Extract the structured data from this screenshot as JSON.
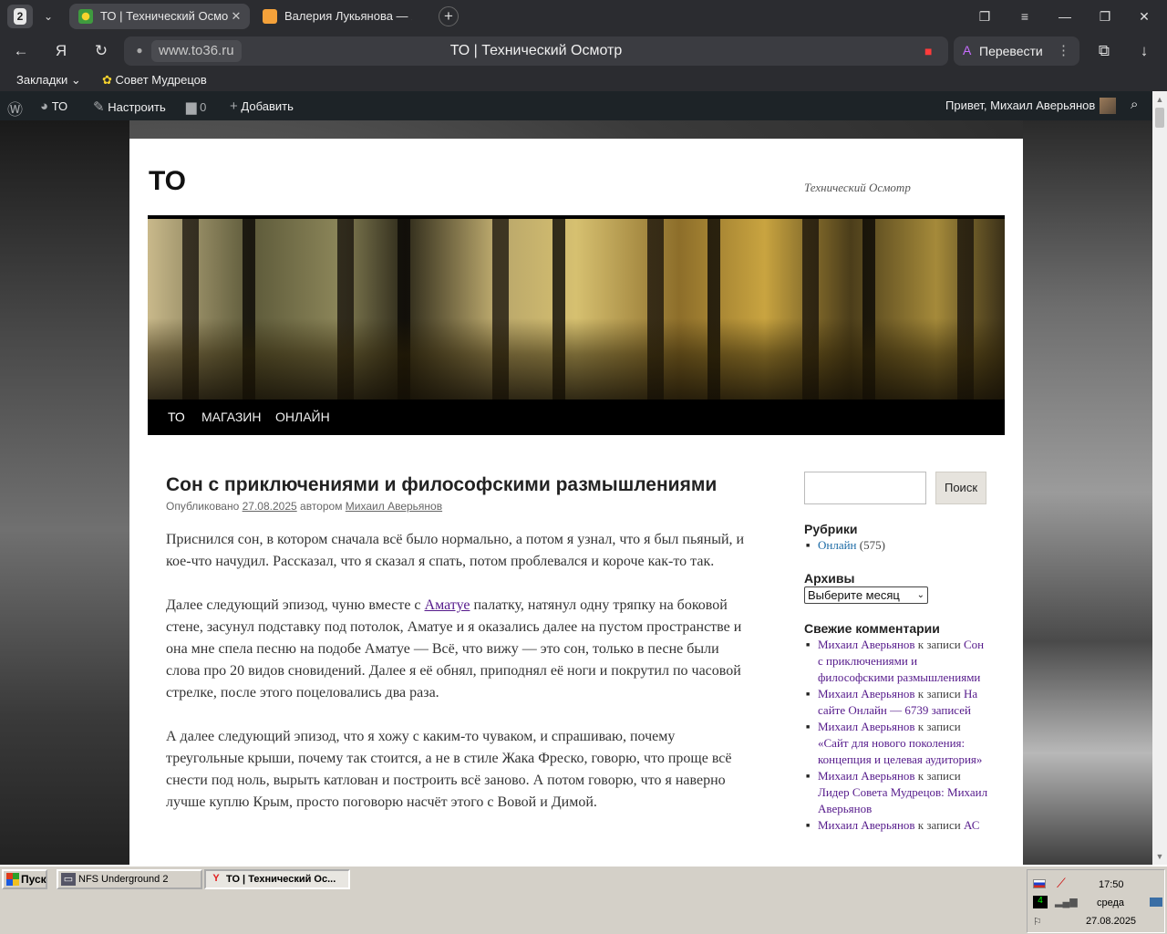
{
  "browser": {
    "tab_count": "2",
    "tabs": [
      {
        "title": "ТО | Технический Осмотр",
        "active": true
      },
      {
        "title": "Валерия Лукьянова — Я",
        "active": false
      }
    ],
    "url": "www.to36.ru",
    "page_title": "ТО | Технический Осмотр",
    "translate_label": "Перевести",
    "bookmarks_label": "Закладки",
    "bookmarks": [
      {
        "label": "Совет Мудрецов"
      }
    ],
    "colors": {
      "chrome": "#2b2c30",
      "bookmark_flag": "#ff3b3b"
    }
  },
  "adminbar": {
    "site": "ТО",
    "customize": "Настроить",
    "comments_count": "0",
    "add_new": "Добавить",
    "greeting": "Привет, Михаил Аверьянов"
  },
  "site": {
    "title": "ТО",
    "description": "Технический Осмотр",
    "menu": [
      {
        "label": "ТО",
        "current": true
      },
      {
        "label": "МАГАЗИН",
        "current": false
      },
      {
        "label": "ОНЛАЙН",
        "current": false
      }
    ]
  },
  "post": {
    "title": "Сон с приключениями и философскими размышлениями",
    "meta_prefix": "Опубликовано",
    "date": "27.08.2025",
    "meta_author_prefix": "автором",
    "author": "Михаил Аверьянов",
    "p1": "Приснился сон, в котором сначала всё было нормально, а потом я узнал, что я был пьяный, и кое-что начудил. Рассказал, что я сказал я спать, потом проблевался и короче как-то так.",
    "p2_before": "Далее следующий эпизод, чуню вместе с ",
    "p2_link": "Аматуе",
    "p2_after": " палатку, натянул одну тряпку на боковой стене, засунул подставку под потолок, Аматуе и я оказались далее на пустом пространстве и она мне спела песню на подобе Аматуе — Всё, что вижу — это сон, только в песне были слова про 20 видов сновидений. Далее я её обнял, приподнял её ноги и покрутил по часовой стрелке, после этого поцеловались два раза.",
    "p3": "А далее следующий эпизод, что я хожу с каким-то чуваком, и спрашиваю, почему треугольные крыши, почему так стоится, а не в стиле Жака Фреско, говорю, что проще всё снести под ноль, вырыть катлован и построить всё заново. А потом говорю, что я наверно лучше куплю Крым, просто поговорю насчёт этого с Вовой и Димой."
  },
  "sidebar": {
    "search_button": "Поиск",
    "search_placeholder": "",
    "categories_title": "Рубрики",
    "categories": [
      {
        "name": "Онлайн",
        "count": "(575)"
      }
    ],
    "archives_title": "Архивы",
    "archives_select": "Выберите месяц",
    "recent_comments_title": "Свежие комментарии",
    "recent_comments": [
      {
        "author": "Михаил Аверьянов",
        "to": "к записи",
        "post": "Сон с приключениями и философскими размышлениями"
      },
      {
        "author": "Михаил Аверьянов",
        "to": "к записи",
        "post": "На сайте Онлайн — 6739 записей"
      },
      {
        "author": "Михаил Аверьянов",
        "to": "к записи",
        "post": "«Сайт для нового поколения: концепция и целевая аудитория»"
      },
      {
        "author": "Михаил Аверьянов",
        "to": "к записи",
        "post": "Лидер Совета Мудрецов: Михаил Аверьянов"
      },
      {
        "author": "Михаил Аверьянов",
        "to": "к записи",
        "post": "АС"
      }
    ]
  },
  "taskbar": {
    "start": "Пуск",
    "tasks": [
      {
        "label": "NFS Underground 2",
        "active": false
      },
      {
        "label": "ТО | Технический Ос...",
        "active": true
      }
    ],
    "time": "17:50",
    "weekday": "среда",
    "date": "27.08.2025"
  }
}
